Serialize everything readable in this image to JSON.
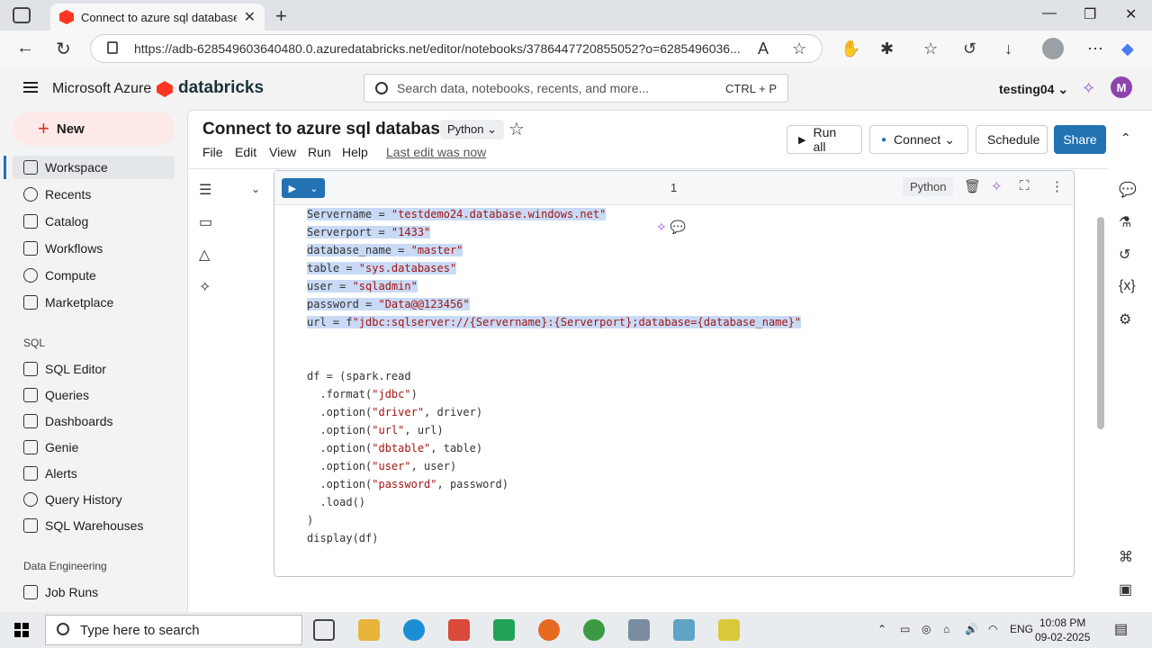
{
  "browser": {
    "tab_title": "Connect to azure sql database - D",
    "url": "https://adb-628549603640480.0.azuredatabricks.net/editor/notebooks/3786447720855052?o=6285496036..."
  },
  "header": {
    "brand": "Microsoft Azure",
    "product": "databricks",
    "search_placeholder": "Search data, notebooks, recents, and more...",
    "search_shortcut": "CTRL + P",
    "workspace": "testing04",
    "avatar_initial": "M"
  },
  "sidebar": {
    "new_label": "New",
    "items": [
      {
        "label": "Workspace"
      },
      {
        "label": "Recents"
      },
      {
        "label": "Catalog"
      },
      {
        "label": "Workflows"
      },
      {
        "label": "Compute"
      },
      {
        "label": "Marketplace"
      }
    ],
    "sql_section": "SQL",
    "sql_items": [
      {
        "label": "SQL Editor"
      },
      {
        "label": "Queries"
      },
      {
        "label": "Dashboards"
      },
      {
        "label": "Genie"
      },
      {
        "label": "Alerts"
      },
      {
        "label": "Query History"
      },
      {
        "label": "SQL Warehouses"
      }
    ],
    "de_section": "Data Engineering",
    "de_items": [
      {
        "label": "Job Runs"
      }
    ]
  },
  "notebook": {
    "title": "Connect to azure sql database",
    "language": "Python",
    "menu": [
      "File",
      "Edit",
      "View",
      "Run",
      "Help"
    ],
    "last_edit": "Last edit was now",
    "run_all": "Run all",
    "connect": "Connect",
    "schedule": "Schedule",
    "share": "Share"
  },
  "cell": {
    "number": "1",
    "language": "Python"
  },
  "taskbar": {
    "search_placeholder": "Type here to search",
    "lang": "ENG",
    "time": "10:08 PM",
    "date": "09-02-2025"
  }
}
